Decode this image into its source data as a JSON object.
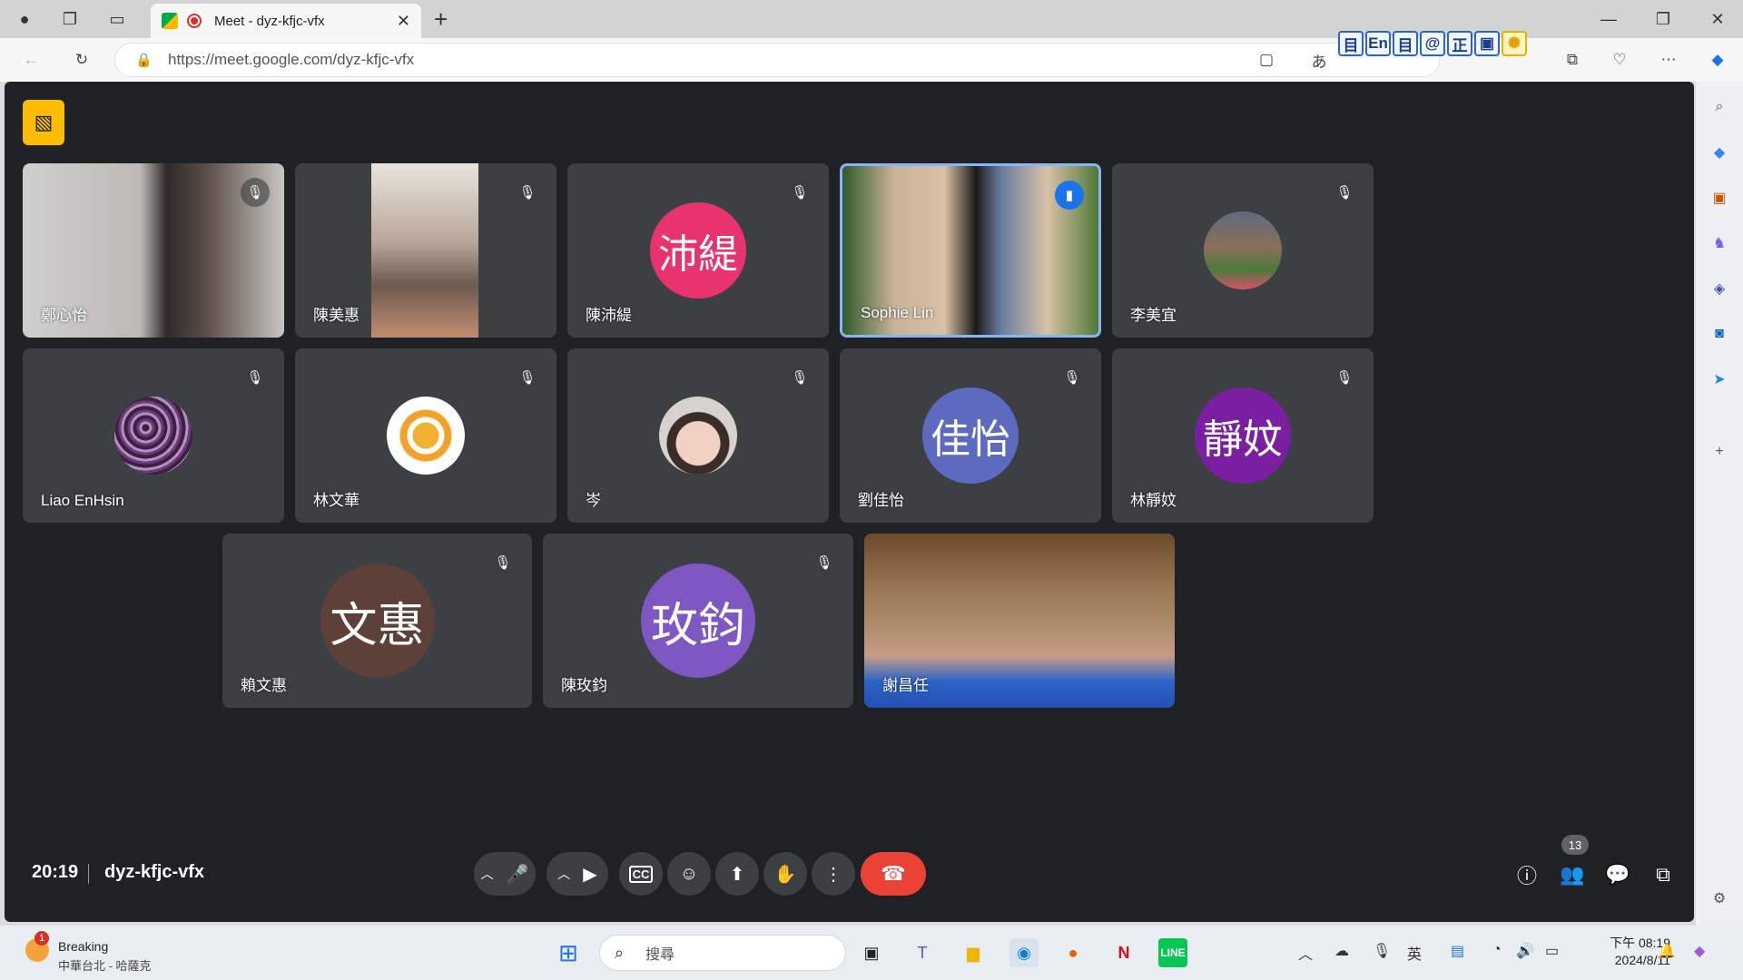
{
  "browser": {
    "tab_title": "Meet - dyz-kfjc-vfx",
    "tab_close": "✕",
    "new_tab": "+",
    "url": "https://meet.google.com/dyz-kfjc-vfx",
    "ime": [
      "目",
      "En",
      "目",
      "@",
      "正",
      "▣",
      "✺"
    ]
  },
  "meeting": {
    "time": "20:19",
    "code": "dyz-kfjc-vfx",
    "participant_count": "13"
  },
  "tiles": [
    {
      "name": "鄭心怡",
      "kind": "video",
      "muted": true
    },
    {
      "name": "陳美惠",
      "kind": "video",
      "muted": true
    },
    {
      "name": "陳沛緹",
      "kind": "avatar",
      "initials": "沛緹",
      "color": "#e8336f",
      "muted": true
    },
    {
      "name": "Sophie Lin",
      "kind": "video",
      "speaking": true
    },
    {
      "name": "李美宜",
      "kind": "photo-avatar",
      "muted": true
    },
    {
      "name": "Liao EnHsin",
      "kind": "photo-avatar",
      "muted": true
    },
    {
      "name": "林文華",
      "kind": "photo-avatar",
      "muted": true
    },
    {
      "name": "岑",
      "kind": "photo-avatar",
      "muted": true
    },
    {
      "name": "劉佳怡",
      "kind": "avatar",
      "initials": "佳怡",
      "color": "#5c6bc0",
      "muted": true
    },
    {
      "name": "林靜妏",
      "kind": "avatar",
      "initials": "靜妏",
      "color": "#7b1fa2",
      "muted": true
    },
    {
      "name": "賴文惠",
      "kind": "avatar",
      "initials": "文惠",
      "color": "#5d4037",
      "muted": true
    },
    {
      "name": "陳玫鈞",
      "kind": "avatar",
      "initials": "玫鈞",
      "color": "#7e57c2",
      "muted": true
    },
    {
      "name": "謝昌任",
      "kind": "video",
      "muted": false
    }
  ],
  "taskbar": {
    "weather_badge": "1",
    "weather_title": "Breaking",
    "weather_sub": "中華台北 - 哈薩克",
    "search_placeholder": "搜尋",
    "time": "下午 08:19",
    "date": "2024/8/11"
  }
}
